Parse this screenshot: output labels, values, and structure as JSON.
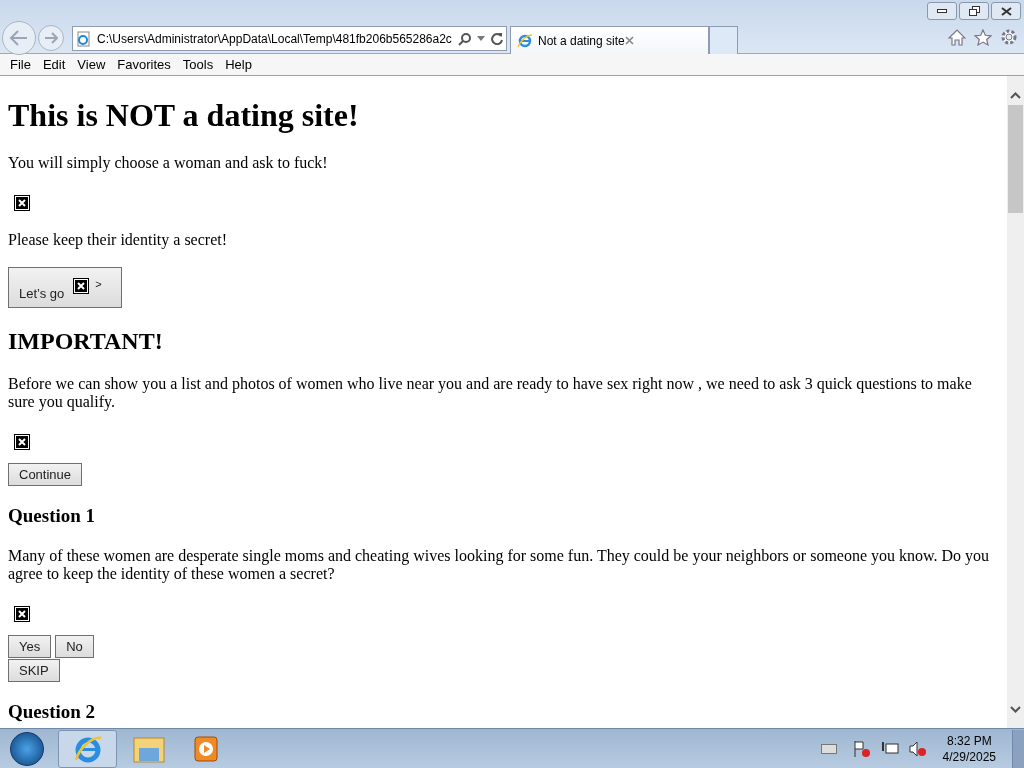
{
  "browser": {
    "address": "C:\\Users\\Administrator\\AppData\\Local\\Temp\\481fb206b565286a2c",
    "tabs": [
      {
        "title": "Not a dating site",
        "selected": true
      }
    ],
    "menu": [
      "File",
      "Edit",
      "View",
      "Favorites",
      "Tools",
      "Help"
    ]
  },
  "page": {
    "blocks": [
      {
        "kind": "heading1",
        "text": "This is NOT a dating site!"
      },
      {
        "kind": "paragraph",
        "text": "You will simply choose a woman and ask to fuck!"
      },
      {
        "kind": "image"
      },
      {
        "kind": "paragraph",
        "text": "Please keep their identity a secret!"
      },
      {
        "kind": "image_button",
        "label": "Let’s go",
        "suffix": ">"
      },
      {
        "kind": "heading2",
        "text": "IMPORTANT!"
      },
      {
        "kind": "paragraph",
        "text": "Before we can show you a list and photos of women who live near you and are ready to have sex right now , we need to ask 3 quick questions to make sure you qualify."
      },
      {
        "kind": "image"
      },
      {
        "kind": "buttons",
        "rows": [
          [
            "Continue"
          ]
        ]
      },
      {
        "kind": "heading3",
        "text": "Question 1"
      },
      {
        "kind": "paragraph",
        "text": "Many of these women are desperate single moms and cheating wives looking for some fun. They could be your neighbors or someone you know. Do you agree to keep the identity of these women a secret?"
      },
      {
        "kind": "image"
      },
      {
        "kind": "buttons",
        "rows": [
          [
            "Yes",
            "No"
          ],
          [
            "SKIP"
          ]
        ]
      },
      {
        "kind": "heading3",
        "text": "Question 2"
      }
    ]
  },
  "taskbar": {
    "time": "8:32 PM",
    "date": "4/29/2025"
  }
}
